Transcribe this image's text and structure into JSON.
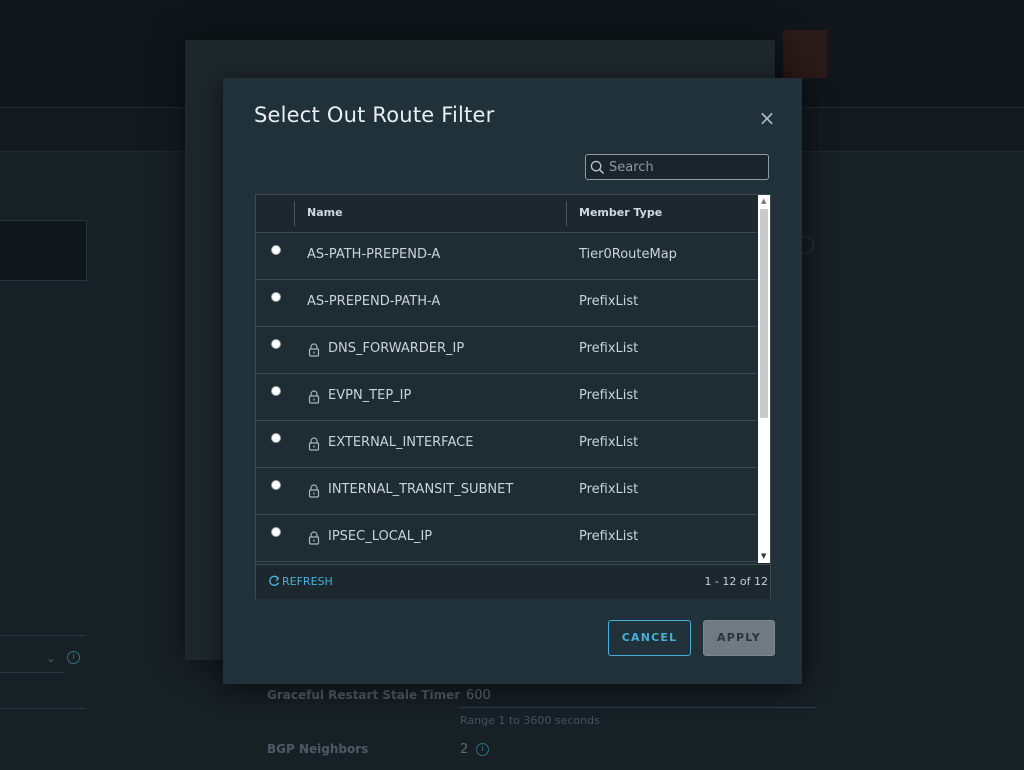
{
  "modal": {
    "title": "Select Out Route Filter",
    "close_icon": "close-icon",
    "search": {
      "placeholder": "Search",
      "value": ""
    },
    "columns": {
      "name": "Name",
      "member_type": "Member Type"
    },
    "rows": [
      {
        "name": "AS-PATH-PREPEND-A",
        "member_type": "Tier0RouteMap",
        "locked": false
      },
      {
        "name": "AS-PREPEND-PATH-A",
        "member_type": "PrefixList",
        "locked": false
      },
      {
        "name": "DNS_FORWARDER_IP",
        "member_type": "PrefixList",
        "locked": true
      },
      {
        "name": "EVPN_TEP_IP",
        "member_type": "PrefixList",
        "locked": true
      },
      {
        "name": "EXTERNAL_INTERFACE",
        "member_type": "PrefixList",
        "locked": true
      },
      {
        "name": "INTERNAL_TRANSIT_SUBNET",
        "member_type": "PrefixList",
        "locked": true
      },
      {
        "name": "IPSEC_LOCAL_IP",
        "member_type": "PrefixList",
        "locked": true
      }
    ],
    "footer": {
      "refresh_label": "REFRESH",
      "pagination": "1 - 12 of 12"
    },
    "buttons": {
      "cancel": "CANCEL",
      "apply": "APPLY"
    }
  },
  "background": {
    "graceful_restart_label": "Graceful Restart Stale Timer",
    "graceful_restart_value": "600",
    "graceful_restart_note": "Range 1 to 3600 seconds",
    "bgp_neighbors_label": "BGP Neighbors",
    "bgp_neighbors_value": "2"
  },
  "colors": {
    "accent": "#49afd9",
    "modal_bg": "#21313a",
    "apply_disabled": "#6f7b80"
  }
}
